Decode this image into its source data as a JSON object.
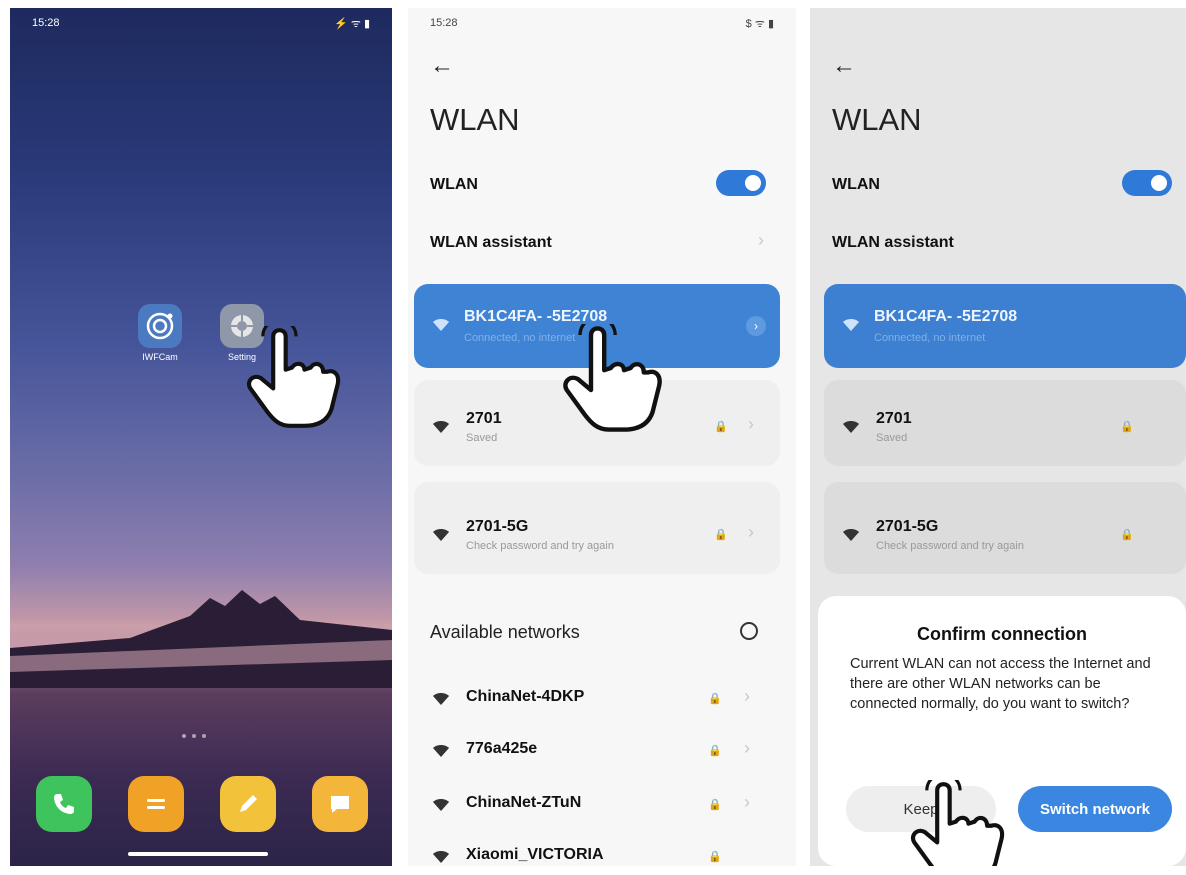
{
  "panel1": {
    "status": {
      "time": "15:28",
      "right": "⚡ ᯤ ▮"
    },
    "apps": [
      {
        "label": "IWFCam",
        "icon": "camera-app-icon"
      },
      {
        "label": "Setting",
        "icon": "settings-app-icon"
      }
    ],
    "dock": [
      {
        "icon": "phone-icon",
        "color": "#3fc35c"
      },
      {
        "icon": "menu-icon",
        "color": "#f0a227"
      },
      {
        "icon": "notes-icon",
        "color": "#f2c23a"
      },
      {
        "icon": "messages-icon",
        "color": "#f4b63a"
      }
    ]
  },
  "panel2": {
    "status": {
      "time": "15:28",
      "right": "$ ᯤ ▮"
    },
    "title": "WLAN",
    "wlan_label": "WLAN",
    "assistant_label": "WLAN assistant",
    "connected": {
      "ssid": "BK1C4FA-    -5E2708",
      "sub": "Connected, no internet"
    },
    "saved": [
      {
        "ssid": "2701",
        "sub": "Saved"
      },
      {
        "ssid": "2701-5G",
        "sub": "Check password and try again"
      }
    ],
    "available_label": "Available networks",
    "available": [
      {
        "ssid": "ChinaNet-4DKP"
      },
      {
        "ssid": "776a425e"
      },
      {
        "ssid": "ChinaNet-ZTuN"
      },
      {
        "ssid": "Xiaomi_VICTORIA"
      }
    ]
  },
  "panel3": {
    "title": "WLAN",
    "wlan_label": "WLAN",
    "assistant_label": "WLAN assistant",
    "connected": {
      "ssid": "BK1C4FA-    -5E2708",
      "sub": "Connected, no internet"
    },
    "saved": [
      {
        "ssid": "2701",
        "sub": "Saved"
      },
      {
        "ssid": "2701-5G",
        "sub": "Check password and try again"
      }
    ],
    "dialog": {
      "title": "Confirm connection",
      "message": "Current WLAN can not access the Internet and there are other WLAN networks can be connected normally, do you want to switch?",
      "keep_label": "Keep",
      "switch_label": "Switch network"
    }
  },
  "colors": {
    "accent": "#3f84d4",
    "toggle": "#2f7ad8"
  }
}
